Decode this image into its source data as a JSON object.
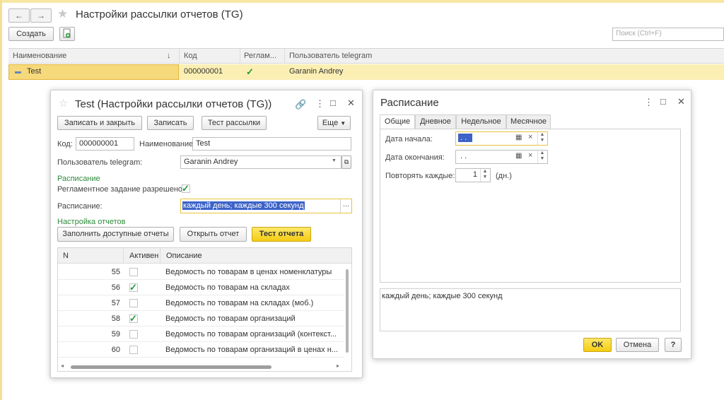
{
  "main": {
    "title": "Настройки рассылки отчетов (TG)",
    "create_label": "Создать",
    "search_placeholder": "Поиск (Ctrl+F)",
    "columns": [
      "Наименование",
      "Код",
      "Реглам...",
      "Пользователь telegram"
    ],
    "sort_indicator": "↓",
    "row": {
      "name": "Test",
      "code": "000000001",
      "scheduled": true,
      "user": "Garanin Andrey"
    }
  },
  "form": {
    "title": "Test (Настройки рассылки отчетов (TG))",
    "buttons": {
      "save_close": "Записать и закрыть",
      "save": "Записать",
      "test_mailing": "Тест рассылки",
      "more": "Еще"
    },
    "code_label": "Код:",
    "code_value": "000000001",
    "name_label": "Наименование:",
    "name_value": "Test",
    "user_label": "Пользователь telegram:",
    "user_value": "Garanin Andrey",
    "schedule_section": "Расписание",
    "scheduled_job_label": "Регламентное задание разрешено:",
    "schedule_label": "Расписание:",
    "schedule_value": "каждый день; каждые 300 секунд",
    "report_section": "Настройка отчетов",
    "fill_btn": "Заполнить доступные отчеты",
    "open_btn": "Открыть отчет",
    "test_btn": "Тест отчета",
    "table_columns": [
      "N",
      "Активен",
      "Описание"
    ],
    "rows": [
      {
        "n": "55",
        "active": false,
        "desc": "Ведомость по товарам в ценах номенклатуры"
      },
      {
        "n": "56",
        "active": true,
        "desc": "Ведомость по товарам на складах"
      },
      {
        "n": "57",
        "active": false,
        "desc": "Ведомость по товарам на складах (моб.)"
      },
      {
        "n": "58",
        "active": true,
        "desc": "Ведомость по товарам организаций"
      },
      {
        "n": "59",
        "active": false,
        "desc": "Ведомость по товарам организаций (контекст..."
      },
      {
        "n": "60",
        "active": false,
        "desc": "Ведомость по товарам организаций в ценах н..."
      }
    ]
  },
  "schedule": {
    "title": "Расписание",
    "tabs": [
      "Общие",
      "Дневное",
      "Недельное",
      "Месячное"
    ],
    "start_label": "Дата начала:",
    "start_value": " .  .",
    "end_label": "Дата окончания:",
    "end_value": " .  .",
    "repeat_label": "Повторять каждые:",
    "repeat_value": "1",
    "repeat_unit": "(дн.)",
    "summary": "каждый день; каждые 300 секунд",
    "ok": "OK",
    "cancel": "Отмена",
    "help": "?"
  },
  "colors": {
    "accent_yellow": "#f4cc12",
    "section_green": "#2e8b3a",
    "selection_blue": "#3d63c8"
  }
}
